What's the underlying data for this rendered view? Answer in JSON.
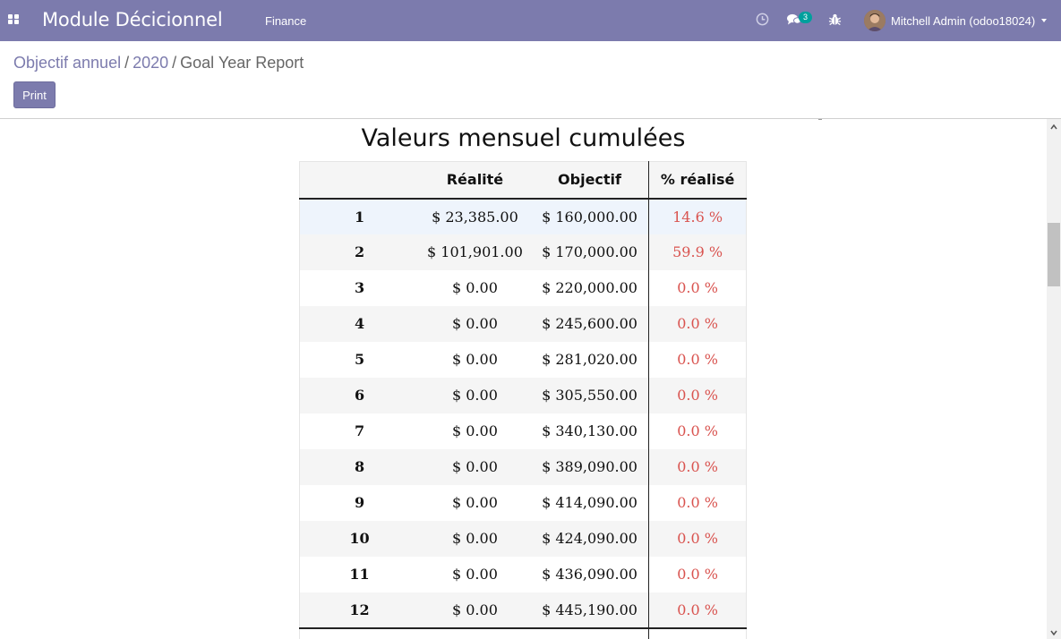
{
  "navbar": {
    "app_title": "Module Décicionnel",
    "menu_finance": "Finance",
    "chat_badge": "3",
    "user_name": "Mitchell Admin (odoo18024)"
  },
  "breadcrumb": {
    "items": [
      "Objectif annuel",
      "2020",
      "Goal Year Report"
    ],
    "separator": "/"
  },
  "toolbar": {
    "print_label": "Print"
  },
  "report": {
    "title": "Valeurs mensuel cumulées",
    "columns": [
      "",
      "Réalité",
      "Objectif",
      "% réalisé"
    ],
    "rows": [
      {
        "month": "1",
        "realite": "$ 23,385.00",
        "objectif": "$ 160,000.00",
        "pct": "14.6 %"
      },
      {
        "month": "2",
        "realite": "$ 101,901.00",
        "objectif": "$ 170,000.00",
        "pct": "59.9 %"
      },
      {
        "month": "3",
        "realite": "$ 0.00",
        "objectif": "$ 220,000.00",
        "pct": "0.0 %"
      },
      {
        "month": "4",
        "realite": "$ 0.00",
        "objectif": "$ 245,600.00",
        "pct": "0.0 %"
      },
      {
        "month": "5",
        "realite": "$ 0.00",
        "objectif": "$ 281,020.00",
        "pct": "0.0 %"
      },
      {
        "month": "6",
        "realite": "$ 0.00",
        "objectif": "$ 305,550.00",
        "pct": "0.0 %"
      },
      {
        "month": "7",
        "realite": "$ 0.00",
        "objectif": "$ 340,130.00",
        "pct": "0.0 %"
      },
      {
        "month": "8",
        "realite": "$ 0.00",
        "objectif": "$ 389,090.00",
        "pct": "0.0 %"
      },
      {
        "month": "9",
        "realite": "$ 0.00",
        "objectif": "$ 414,090.00",
        "pct": "0.0 %"
      },
      {
        "month": "10",
        "realite": "$ 0.00",
        "objectif": "$ 424,090.00",
        "pct": "0.0 %"
      },
      {
        "month": "11",
        "realite": "$ 0.00",
        "objectif": "$ 436,090.00",
        "pct": "0.0 %"
      },
      {
        "month": "12",
        "realite": "$ 0.00",
        "objectif": "$ 445,190.00",
        "pct": "0.0 %"
      }
    ]
  },
  "icons": {
    "apps": "apps-grid-icon",
    "activity": "clock-icon",
    "messaging": "chat-bubbles-icon",
    "debug": "bug-icon",
    "user_menu": "caret-down-icon"
  },
  "colors": {
    "navbar": "#7c7bad",
    "link": "#7c7bad",
    "button": "#7c7bad",
    "badge": "#00a09d",
    "percentage": "#d9534f",
    "row_hover": "#eef4fc",
    "row_stripe": "#f5f5f5"
  }
}
